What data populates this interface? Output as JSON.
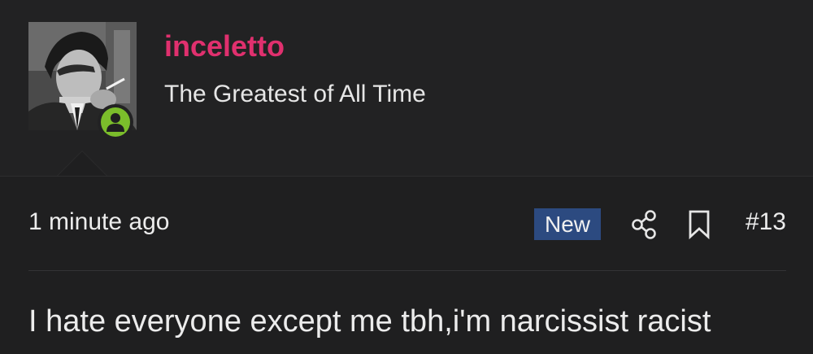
{
  "user": {
    "name": "inceletto",
    "title": "The Greatest of All Time",
    "avatar_icon": "user-avatar-photo",
    "online_icon": "person-icon",
    "online_color": "#7bbd2b",
    "name_color": "#e0306e"
  },
  "post": {
    "time": "1 minute ago",
    "new_label": "New",
    "share_icon": "share-icon",
    "bookmark_icon": "bookmark-icon",
    "number": "#13",
    "body": "I hate everyone except me tbh,i'm narcissist racist"
  }
}
